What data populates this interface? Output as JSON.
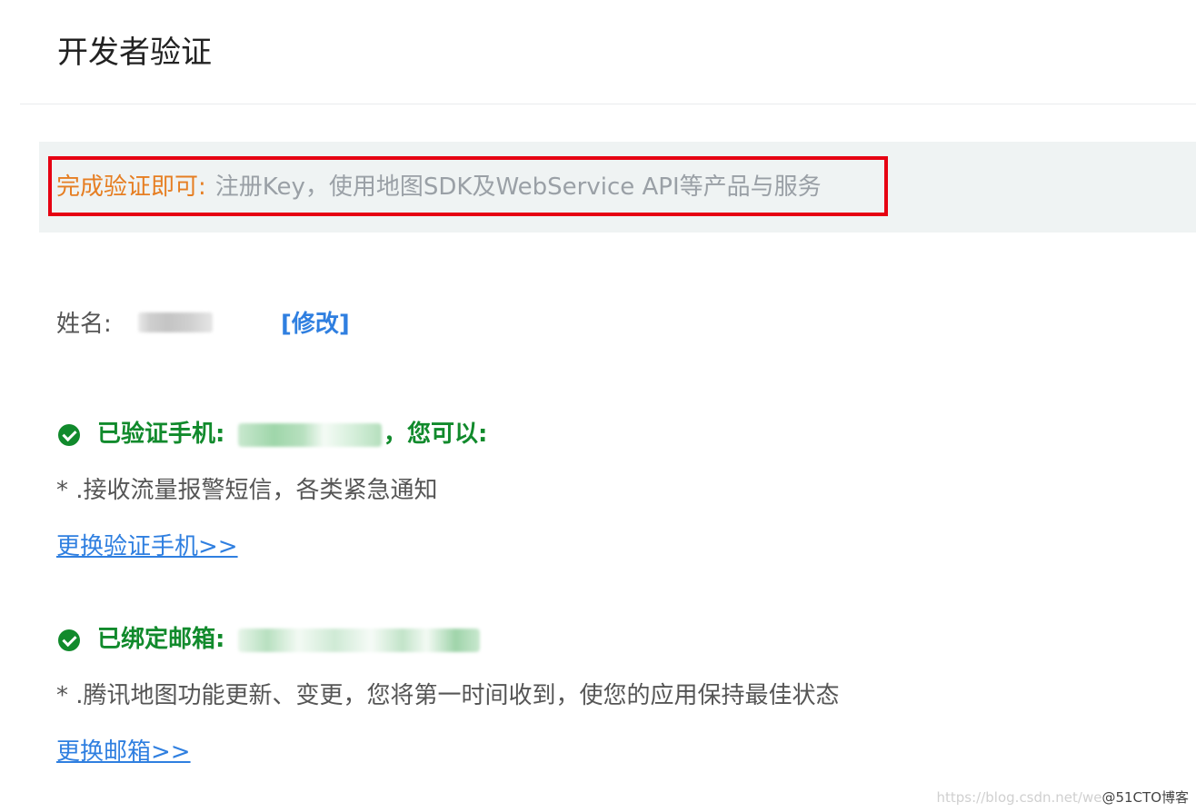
{
  "page": {
    "title": "开发者验证"
  },
  "notice": {
    "label": "完成验证即可:",
    "description": "注册Key，使用地图SDK及WebService API等产品与服务"
  },
  "name_section": {
    "label": "姓名:",
    "edit_link": "[修改]"
  },
  "phone_section": {
    "label": "已验证手机:",
    "suffix": "，您可以:",
    "benefit": "* .接收流量报警短信，各类紧急通知",
    "change_link": "更换验证手机>>"
  },
  "email_section": {
    "label": "已绑定邮箱:",
    "benefit": "* .腾讯地图功能更新、变更，您将第一时间收到，使您的应用保持最佳状态",
    "change_link": "更换邮箱>>"
  },
  "watermark": {
    "url": "https://blog.csdn.net/we",
    "brand": "@51CTO博客"
  },
  "colors": {
    "accent_link": "#2f7fe0",
    "success_green": "#118a2c",
    "notice_orange": "#e67e22",
    "highlight_red": "#e60012"
  }
}
